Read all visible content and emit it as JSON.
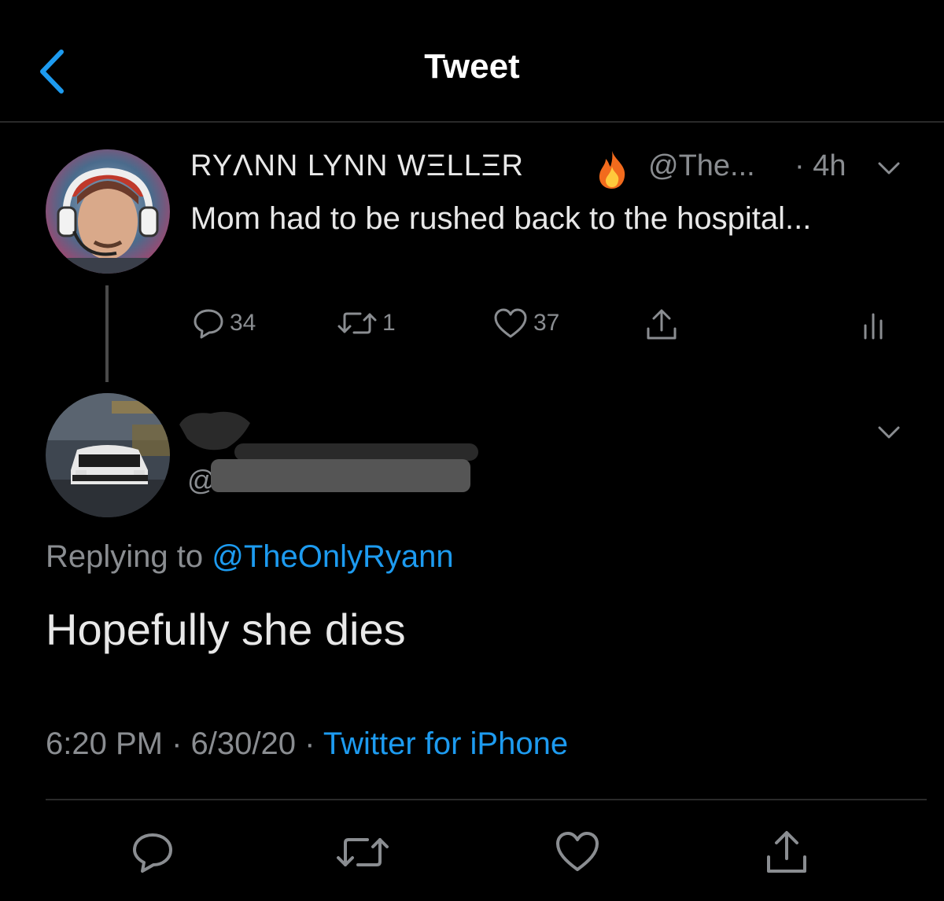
{
  "header": {
    "title": "Tweet"
  },
  "parent_tweet": {
    "display_name": "RYΛNN LYNN WΞLLΞR",
    "handle": "@The...",
    "time": "· 4h",
    "text": "Mom had to be rushed back to the hospital...",
    "counts": {
      "replies": "34",
      "retweets": "1",
      "likes": "37"
    }
  },
  "reply_tweet": {
    "handle_prefix": "@",
    "replying_label": "Replying to",
    "replying_handle": "@TheOnlyRyann",
    "text": "Hopefully she dies",
    "time": "6:20 PM",
    "date": "6/30/20",
    "source": "Twitter for iPhone"
  },
  "colors": {
    "accent": "#1d9bf0",
    "muted": "#8a8d91",
    "background": "#000000"
  }
}
